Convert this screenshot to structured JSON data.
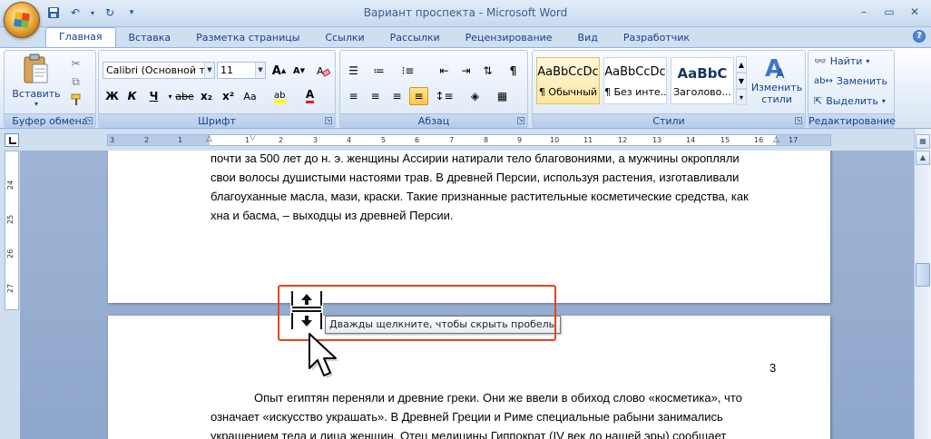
{
  "window": {
    "title": "Вариант проспекта - Microsoft Word"
  },
  "tabs": [
    "Главная",
    "Вставка",
    "Разметка страницы",
    "Ссылки",
    "Рассылки",
    "Рецензирование",
    "Вид",
    "Разработчик"
  ],
  "active_tab": "Главная",
  "ribbon": {
    "clipboard": {
      "label": "Буфер обмена",
      "paste": "Вставить"
    },
    "font": {
      "label": "Шрифт",
      "font_name": "Calibri (Основной те",
      "font_size": "11",
      "bold": "Ж",
      "italic": "К",
      "underline": "Ч",
      "strike": "abe",
      "sub": "x₂",
      "sup": "x²",
      "case": "Аа",
      "grow": "A",
      "shrink": "A",
      "font_color": "A"
    },
    "paragraph": {
      "label": "Абзац"
    },
    "styles": {
      "label": "Стили",
      "items": [
        {
          "sample": "AaBbCcDc",
          "name": "¶ Обычный"
        },
        {
          "sample": "AaBbCcDc",
          "name": "¶ Без инте..."
        },
        {
          "sample": "AaBbC",
          "name": "Заголово..."
        }
      ],
      "change": "Изменить стили"
    },
    "editing": {
      "label": "Редактирование",
      "find": "Найти",
      "replace": "Заменить",
      "select": "Выделить"
    }
  },
  "ruler": {
    "h_ticks": [
      "3",
      "2",
      "1",
      "1",
      "2",
      "3",
      "4",
      "5",
      "6",
      "7",
      "8",
      "9",
      "10",
      "11",
      "12",
      "13",
      "14",
      "15",
      "16",
      "17"
    ],
    "v_ticks": [
      "24",
      "25",
      "26",
      "27"
    ]
  },
  "document": {
    "page1_lines": [
      "почти за 500 лет до н. э. женщины Ассирии натирали тело благовониями, а мужчины окропляли",
      "свои волосы душистыми настоями трав. В древней Персии, используя растения, изготавливали",
      "благоуханные масла, мази, краски. Такие признанные растительные косметические средства, как",
      "хна и басма, – выходцы из древней Персии."
    ],
    "page2_number": "3",
    "page2_lines": [
      "Опыт египтян переняли и древние греки. Они же ввели в обиход слово «косметика», что",
      "означает «искусство украшать». В Древней Греции и Риме специальные рабыни занимались",
      "украшением тела и лица женщин. Отец медицины Гиппократ (IV век до нашей эры) сообщает"
    ]
  },
  "tooltip": "Дважды щелкните, чтобы скрыть пробелы",
  "colors": {
    "highlight": "#e5431a",
    "ribbon_text": "#15428b",
    "doc_background": "#9fb4d4"
  }
}
